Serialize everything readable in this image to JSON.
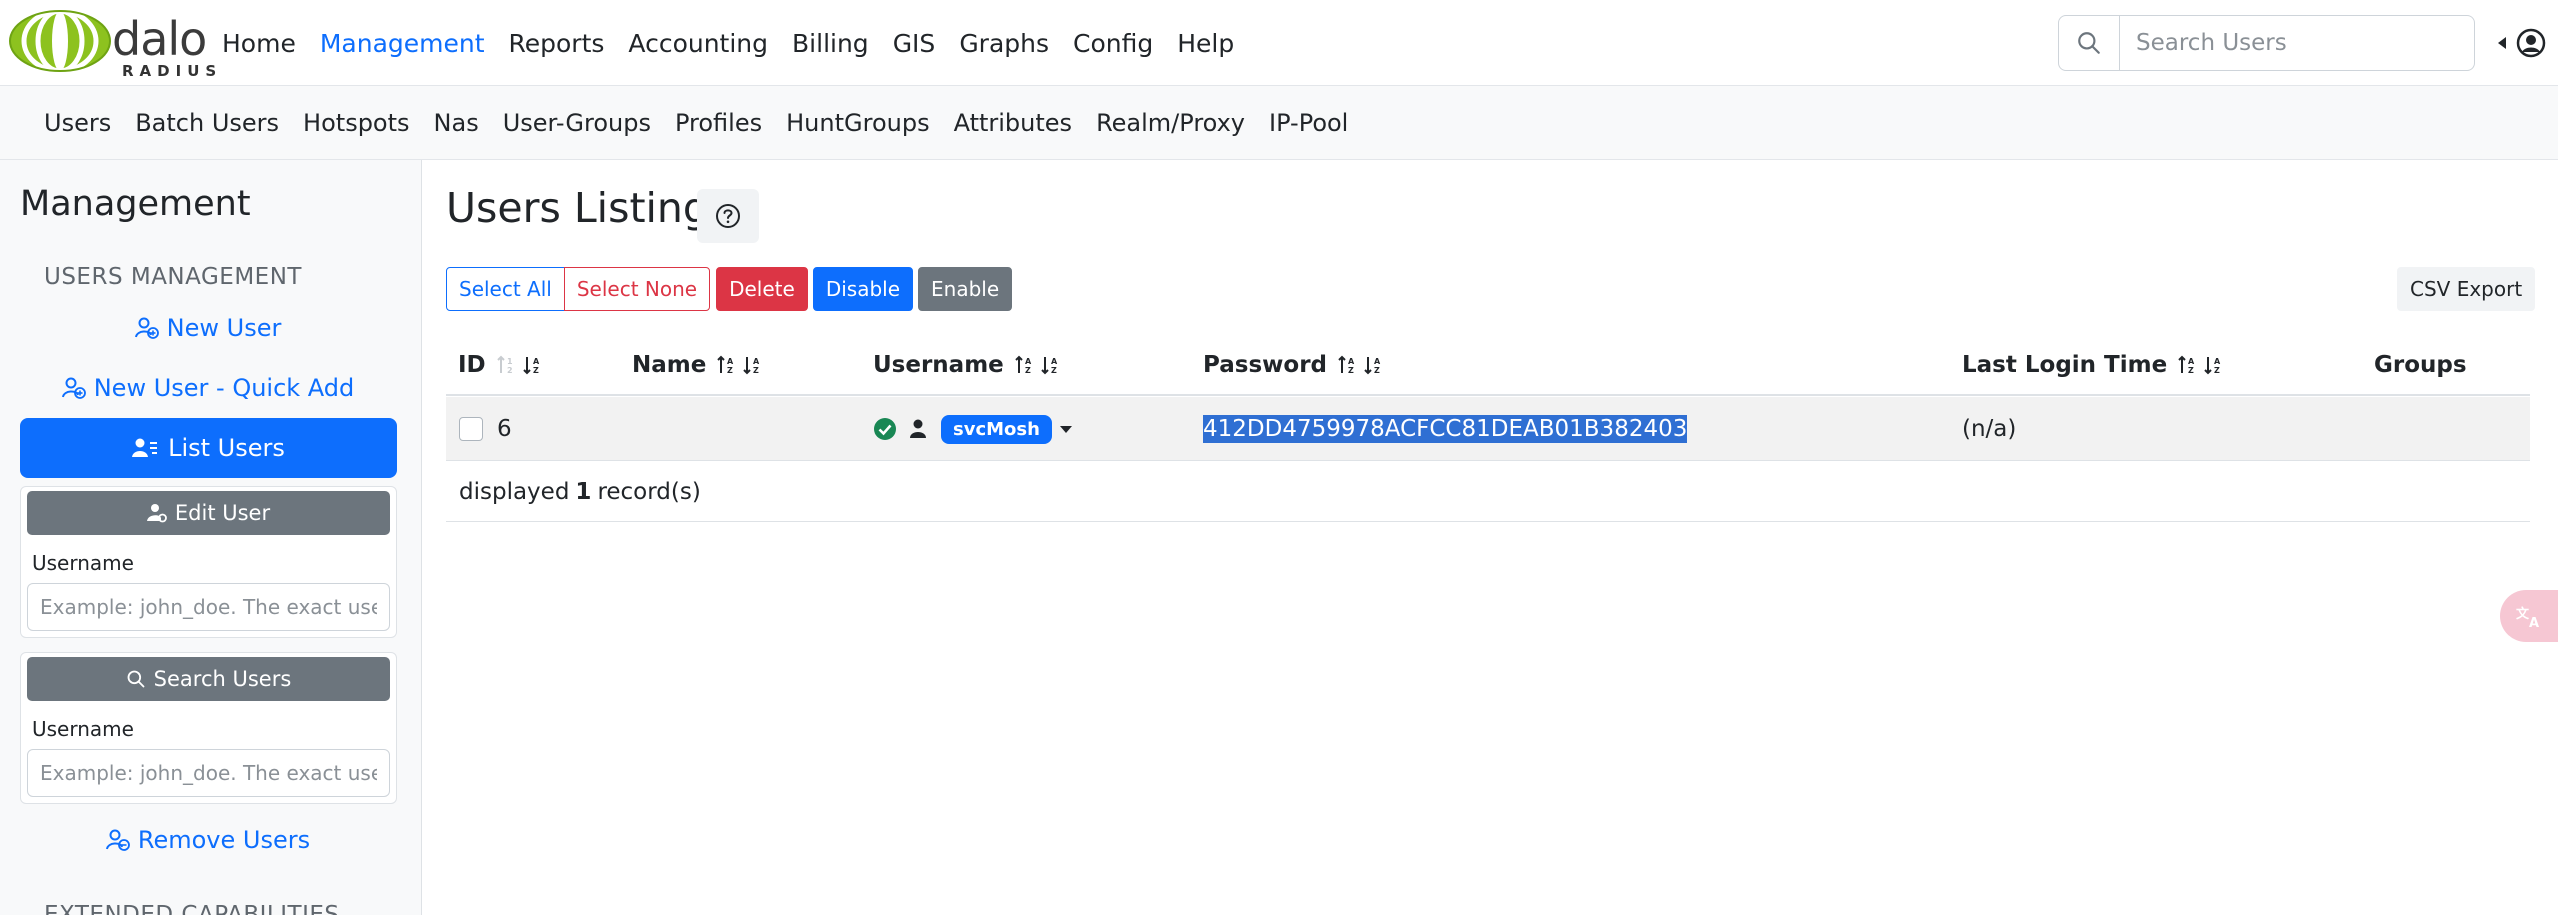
{
  "brand": {
    "name": "dalo",
    "sub": "RADIUS"
  },
  "topnav": {
    "items": [
      {
        "label": "Home",
        "active": false
      },
      {
        "label": "Management",
        "active": true
      },
      {
        "label": "Reports",
        "active": false
      },
      {
        "label": "Accounting",
        "active": false
      },
      {
        "label": "Billing",
        "active": false
      },
      {
        "label": "GIS",
        "active": false
      },
      {
        "label": "Graphs",
        "active": false
      },
      {
        "label": "Config",
        "active": false
      },
      {
        "label": "Help",
        "active": false
      }
    ],
    "search_placeholder": "Search Users"
  },
  "subnav": {
    "items": [
      "Users",
      "Batch Users",
      "Hotspots",
      "Nas",
      "User-Groups",
      "Profiles",
      "HuntGroups",
      "Attributes",
      "Realm/Proxy",
      "IP-Pool"
    ]
  },
  "sidebar": {
    "title": "Management",
    "section": "USERS MANAGEMENT",
    "new_user": "New User",
    "new_user_quick": "New User - Quick Add",
    "list_users": "List Users",
    "edit_user": {
      "button": "Edit User",
      "label": "Username",
      "placeholder": "Example: john_doe. The exact username"
    },
    "search_users": {
      "button": "Search Users",
      "label": "Username",
      "placeholder": "Example: john_doe. The exact username"
    },
    "remove_users": "Remove Users",
    "next_section": "EXTENDED CAPABILITIES"
  },
  "main": {
    "title": "Users Listing",
    "buttons": {
      "select_all": "Select All",
      "select_none": "Select None",
      "delete": "Delete",
      "disable": "Disable",
      "enable": "Enable",
      "csv_export": "CSV Export"
    },
    "columns": {
      "id": "ID",
      "name": "Name",
      "username": "Username",
      "password": "Password",
      "last_login": "Last Login Time",
      "groups": "Groups"
    },
    "rows": [
      {
        "id": "6",
        "name": "",
        "username": "svcMosh",
        "password": "412DD4759978ACFCC81DEAB01B382403",
        "last_login": "(n/a)",
        "groups": ""
      }
    ],
    "footer": {
      "prefix": "displayed",
      "count": "1",
      "suffix": "record(s)"
    }
  },
  "colors": {
    "primary": "#0d6efd",
    "danger": "#dc3545",
    "secondary": "#6c757d",
    "success": "#198754",
    "logo_green": "#8dc21f"
  }
}
